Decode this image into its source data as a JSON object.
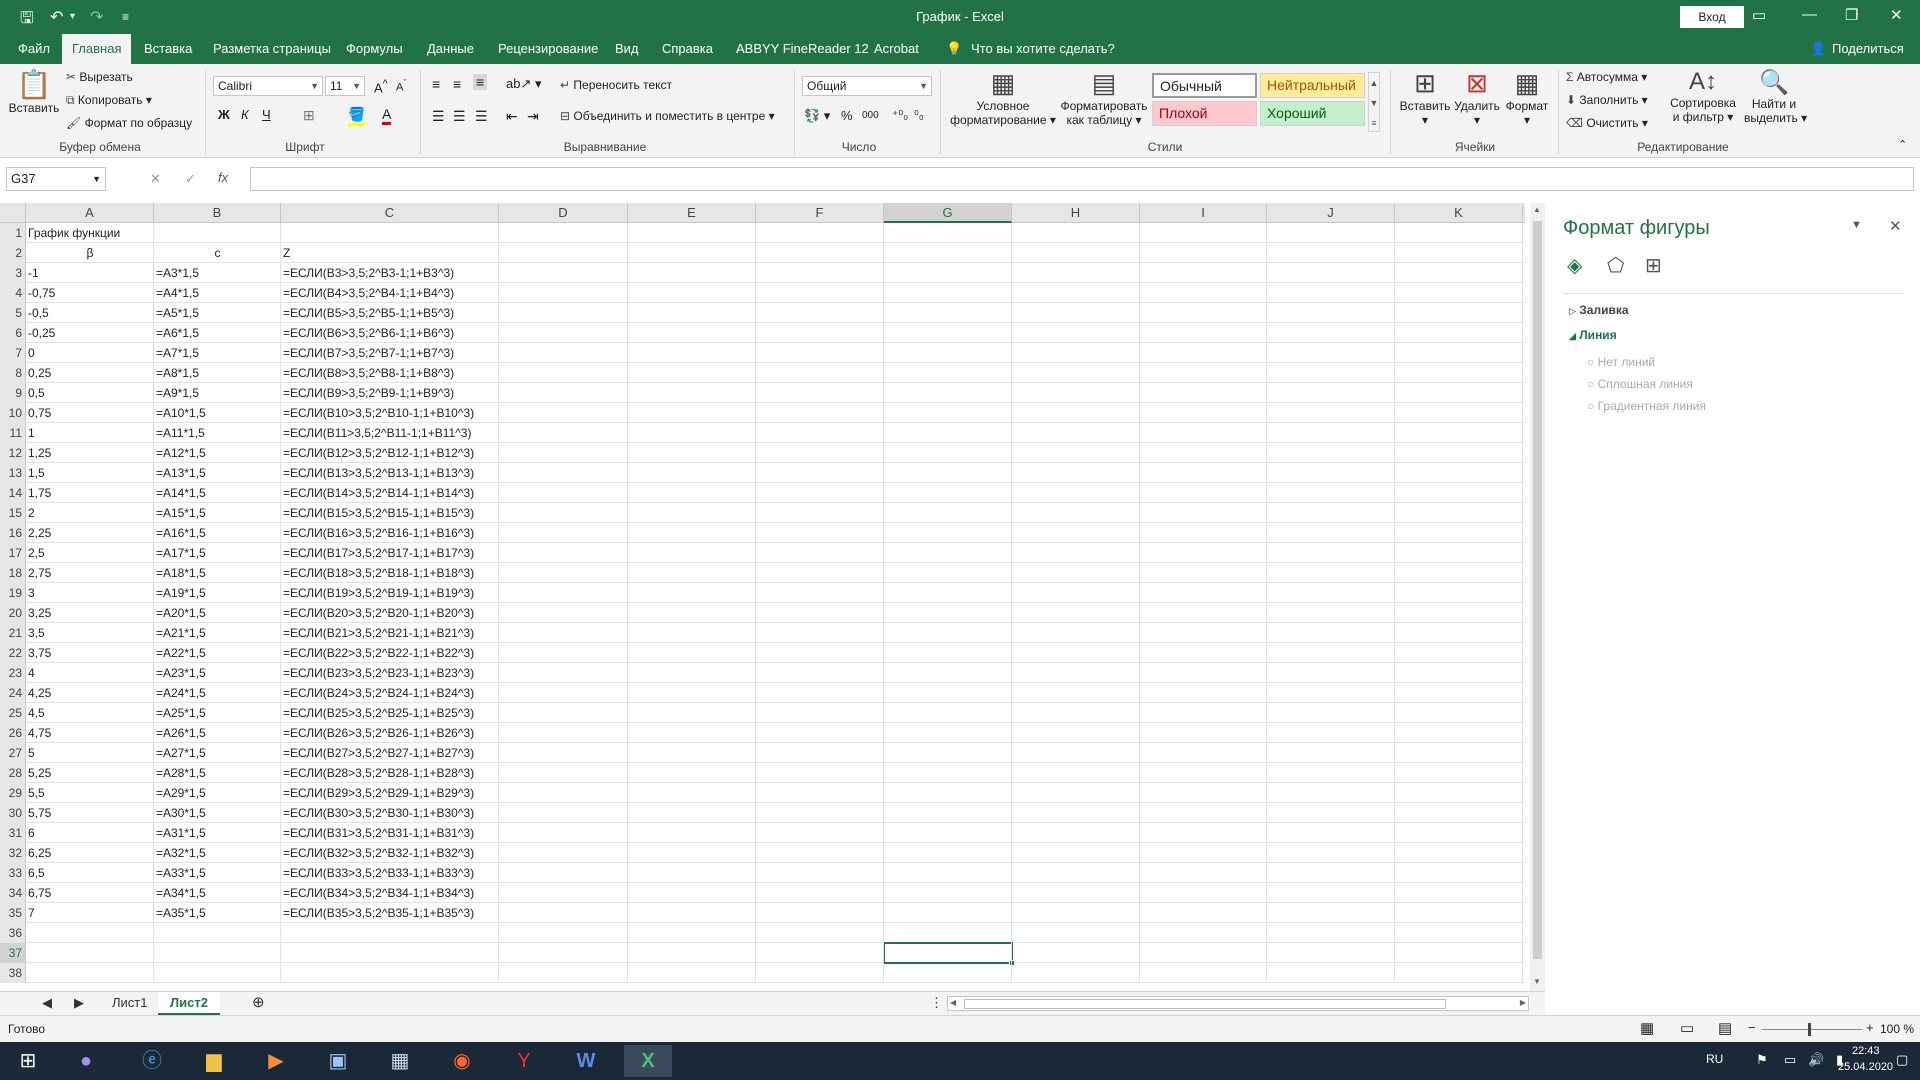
{
  "window": {
    "title": "График - Excel",
    "login_label": "Вход",
    "minimize": "—",
    "maximize": "❐",
    "close": "✕"
  },
  "ribbon_tabs": [
    "Файл",
    "Главная",
    "Вставка",
    "Разметка страницы",
    "Формулы",
    "Данные",
    "Рецензирование",
    "Вид",
    "Справка",
    "ABBYY FineReader 12",
    "Acrobat"
  ],
  "tell_me": "Что вы хотите сделать?",
  "share_label": "Поделиться",
  "clipboard": {
    "paste": "Вставить",
    "cut": "Вырезать",
    "copy": "Копировать",
    "format_painter": "Формат по образцу",
    "label": "Буфер обмена"
  },
  "font": {
    "family": "Calibri",
    "size": "11",
    "bold": "Ж",
    "italic": "К",
    "underline": "Ч",
    "label": "Шрифт"
  },
  "alignment": {
    "wrap_text": "Переносить текст",
    "merge_center": "Объединить и поместить в центре",
    "label": "Выравнивание"
  },
  "number": {
    "format": "Общий",
    "percent": "%",
    "thousands": "000",
    "label": "Число"
  },
  "styles": {
    "conditional": "Условное форматирование",
    "conditional_l1": "Условное",
    "conditional_l2": "форматирование",
    "as_table_l1": "Форматировать",
    "as_table_l2": "как таблицу",
    "normal": "Обычный",
    "neutral": "Нейтральный",
    "bad": "Плохой",
    "good": "Хороший",
    "label": "Стили"
  },
  "cells": {
    "insert": "Вставить",
    "delete": "Удалить",
    "format": "Формат",
    "label": "Ячейки"
  },
  "editing": {
    "autosum": "Автосумма",
    "fill": "Заполнить",
    "clear": "Очистить",
    "sort_l1": "Сортировка",
    "sort_l2": "и фильтр",
    "find_l1": "Найти и",
    "find_l2": "выделить",
    "label": "Редактирование"
  },
  "name_box": "G37",
  "fx_label": "fx",
  "columns": [
    "A",
    "B",
    "C",
    "D",
    "E",
    "F",
    "G",
    "H",
    "I",
    "J",
    "K"
  ],
  "rows": [
    {
      "n": "1",
      "a": "График функции",
      "b": "",
      "c": ""
    },
    {
      "n": "2",
      "a": "β",
      "b": "c",
      "c": "Z"
    },
    {
      "n": "3",
      "a": "-1",
      "b": "=A3*1,5",
      "c": "=ЕСЛИ(B3>3,5;2^B3-1;1+B3^3)"
    },
    {
      "n": "4",
      "a": "-0,75",
      "b": "=A4*1,5",
      "c": "=ЕСЛИ(B4>3,5;2^B4-1;1+B4^3)"
    },
    {
      "n": "5",
      "a": "-0,5",
      "b": "=A5*1,5",
      "c": "=ЕСЛИ(B5>3,5;2^B5-1;1+B5^3)"
    },
    {
      "n": "6",
      "a": "-0,25",
      "b": "=A6*1,5",
      "c": "=ЕСЛИ(B6>3,5;2^B6-1;1+B6^3)"
    },
    {
      "n": "7",
      "a": "0",
      "b": "=A7*1,5",
      "c": "=ЕСЛИ(B7>3,5;2^B7-1;1+B7^3)"
    },
    {
      "n": "8",
      "a": "0,25",
      "b": "=A8*1,5",
      "c": "=ЕСЛИ(B8>3,5;2^B8-1;1+B8^3)"
    },
    {
      "n": "9",
      "a": "0,5",
      "b": "=A9*1,5",
      "c": "=ЕСЛИ(B9>3,5;2^B9-1;1+B9^3)"
    },
    {
      "n": "10",
      "a": "0,75",
      "b": "=A10*1,5",
      "c": "=ЕСЛИ(B10>3,5;2^B10-1;1+B10^3)"
    },
    {
      "n": "11",
      "a": "1",
      "b": "=A11*1,5",
      "c": "=ЕСЛИ(B11>3,5;2^B11-1;1+B11^3)"
    },
    {
      "n": "12",
      "a": "1,25",
      "b": "=A12*1,5",
      "c": "=ЕСЛИ(B12>3,5;2^B12-1;1+B12^3)"
    },
    {
      "n": "13",
      "a": "1,5",
      "b": "=A13*1,5",
      "c": "=ЕСЛИ(B13>3,5;2^B13-1;1+B13^3)"
    },
    {
      "n": "14",
      "a": "1,75",
      "b": "=A14*1,5",
      "c": "=ЕСЛИ(B14>3,5;2^B14-1;1+B14^3)"
    },
    {
      "n": "15",
      "a": "2",
      "b": "=A15*1,5",
      "c": "=ЕСЛИ(B15>3,5;2^B15-1;1+B15^3)"
    },
    {
      "n": "16",
      "a": "2,25",
      "b": "=A16*1,5",
      "c": "=ЕСЛИ(B16>3,5;2^B16-1;1+B16^3)"
    },
    {
      "n": "17",
      "a": "2,5",
      "b": "=A17*1,5",
      "c": "=ЕСЛИ(B17>3,5;2^B17-1;1+B17^3)"
    },
    {
      "n": "18",
      "a": "2,75",
      "b": "=A18*1,5",
      "c": "=ЕСЛИ(B18>3,5;2^B18-1;1+B18^3)"
    },
    {
      "n": "19",
      "a": "3",
      "b": "=A19*1,5",
      "c": "=ЕСЛИ(B19>3,5;2^B19-1;1+B19^3)"
    },
    {
      "n": "20",
      "a": "3,25",
      "b": "=A20*1,5",
      "c": "=ЕСЛИ(B20>3,5;2^B20-1;1+B20^3)"
    },
    {
      "n": "21",
      "a": "3,5",
      "b": "=A21*1,5",
      "c": "=ЕСЛИ(B21>3,5;2^B21-1;1+B21^3)"
    },
    {
      "n": "22",
      "a": "3,75",
      "b": "=A22*1,5",
      "c": "=ЕСЛИ(B22>3,5;2^B22-1;1+B22^3)"
    },
    {
      "n": "23",
      "a": "4",
      "b": "=A23*1,5",
      "c": "=ЕСЛИ(B23>3,5;2^B23-1;1+B23^3)"
    },
    {
      "n": "24",
      "a": "4,25",
      "b": "=A24*1,5",
      "c": "=ЕСЛИ(B24>3,5;2^B24-1;1+B24^3)"
    },
    {
      "n": "25",
      "a": "4,5",
      "b": "=A25*1,5",
      "c": "=ЕСЛИ(B25>3,5;2^B25-1;1+B25^3)"
    },
    {
      "n": "26",
      "a": "4,75",
      "b": "=A26*1,5",
      "c": "=ЕСЛИ(B26>3,5;2^B26-1;1+B26^3)"
    },
    {
      "n": "27",
      "a": "5",
      "b": "=A27*1,5",
      "c": "=ЕСЛИ(B27>3,5;2^B27-1;1+B27^3)"
    },
    {
      "n": "28",
      "a": "5,25",
      "b": "=A28*1,5",
      "c": "=ЕСЛИ(B28>3,5;2^B28-1;1+B28^3)"
    },
    {
      "n": "29",
      "a": "5,5",
      "b": "=A29*1,5",
      "c": "=ЕСЛИ(B29>3,5;2^B29-1;1+B29^3)"
    },
    {
      "n": "30",
      "a": "5,75",
      "b": "=A30*1,5",
      "c": "=ЕСЛИ(B30>3,5;2^B30-1;1+B30^3)"
    },
    {
      "n": "31",
      "a": "6",
      "b": "=A31*1,5",
      "c": "=ЕСЛИ(B31>3,5;2^B31-1;1+B31^3)"
    },
    {
      "n": "32",
      "a": "6,25",
      "b": "=A32*1,5",
      "c": "=ЕСЛИ(B32>3,5;2^B32-1;1+B32^3)"
    },
    {
      "n": "33",
      "a": "6,5",
      "b": "=A33*1,5",
      "c": "=ЕСЛИ(B33>3,5;2^B33-1;1+B33^3)"
    },
    {
      "n": "34",
      "a": "6,75",
      "b": "=A34*1,5",
      "c": "=ЕСЛИ(B34>3,5;2^B34-1;1+B34^3)"
    },
    {
      "n": "35",
      "a": "7",
      "b": "=A35*1,5",
      "c": "=ЕСЛИ(B35>3,5;2^B35-1;1+B35^3)"
    },
    {
      "n": "36",
      "a": "",
      "b": "",
      "c": ""
    },
    {
      "n": "37",
      "a": "",
      "b": "",
      "c": ""
    },
    {
      "n": "38",
      "a": "",
      "b": "",
      "c": ""
    }
  ],
  "selected_cell": {
    "column": "G",
    "row": "37"
  },
  "sheet_tabs": [
    "Лист1",
    "Лист2"
  ],
  "active_sheet": "Лист2",
  "panel": {
    "title": "Формат фигуры",
    "fill": "Заливка",
    "line": "Линия",
    "options": [
      "Нет линий",
      "Сплошная линия",
      "Градиентная линия"
    ]
  },
  "status": {
    "ready": "Готово",
    "zoom": "100 %",
    "zoom_minus": "−",
    "zoom_plus": "+"
  },
  "taskbar": {
    "lang": "RU",
    "time": "22:43",
    "date": "25.04.2020"
  },
  "colors": {
    "excel_green": "#217346",
    "neutral_bg": "#ffeb9c",
    "neutral_text": "#9c5700",
    "bad_bg": "#ffc7ce",
    "bad_text": "#9c0006",
    "good_bg": "#c6efce",
    "good_text": "#006100"
  }
}
